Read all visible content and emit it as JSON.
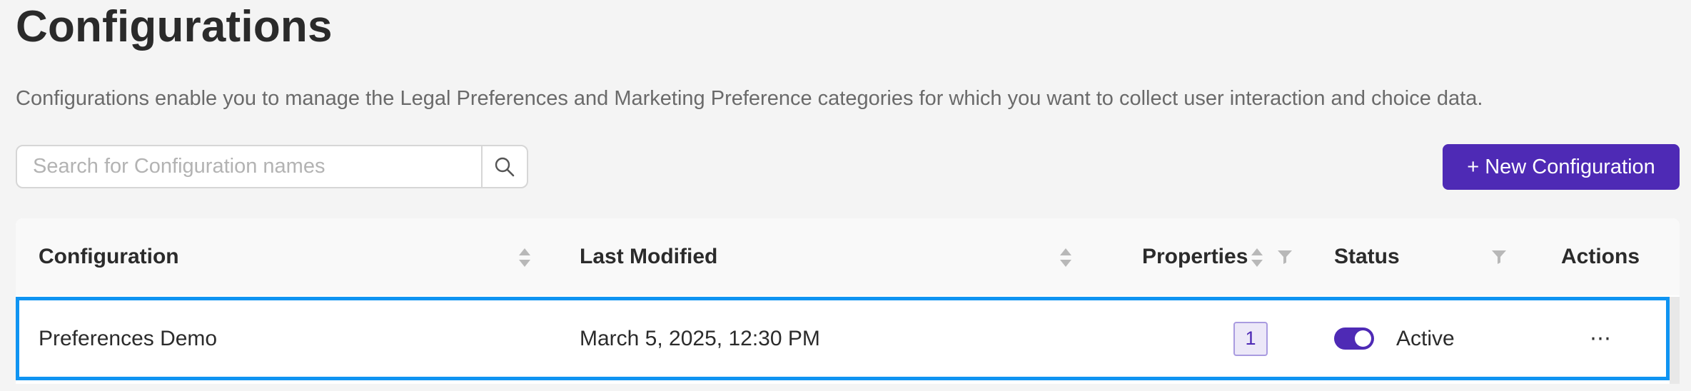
{
  "page": {
    "title": "Configurations",
    "description": "Configurations enable you to manage the Legal Preferences and Marketing Preference categories for which you want to collect user interaction and choice data."
  },
  "search": {
    "placeholder": "Search for Configuration names",
    "value": ""
  },
  "toolbar": {
    "new_label": "+ New Configuration"
  },
  "table": {
    "columns": {
      "configuration": "Configuration",
      "last_modified": "Last Modified",
      "properties": "Properties",
      "status": "Status",
      "actions": "Actions"
    },
    "rows": [
      {
        "configuration": "Preferences Demo",
        "last_modified": "March 5, 2025, 12:30 PM",
        "properties": "1",
        "status": "Active",
        "status_enabled": true,
        "actions": "⋯"
      }
    ]
  },
  "colors": {
    "accent": "#4e2ab5",
    "selection": "#0f94f2"
  },
  "icons": {
    "search": "search-icon",
    "sort": "sort-icon",
    "filter": "filter-icon",
    "more": "more-icon"
  }
}
